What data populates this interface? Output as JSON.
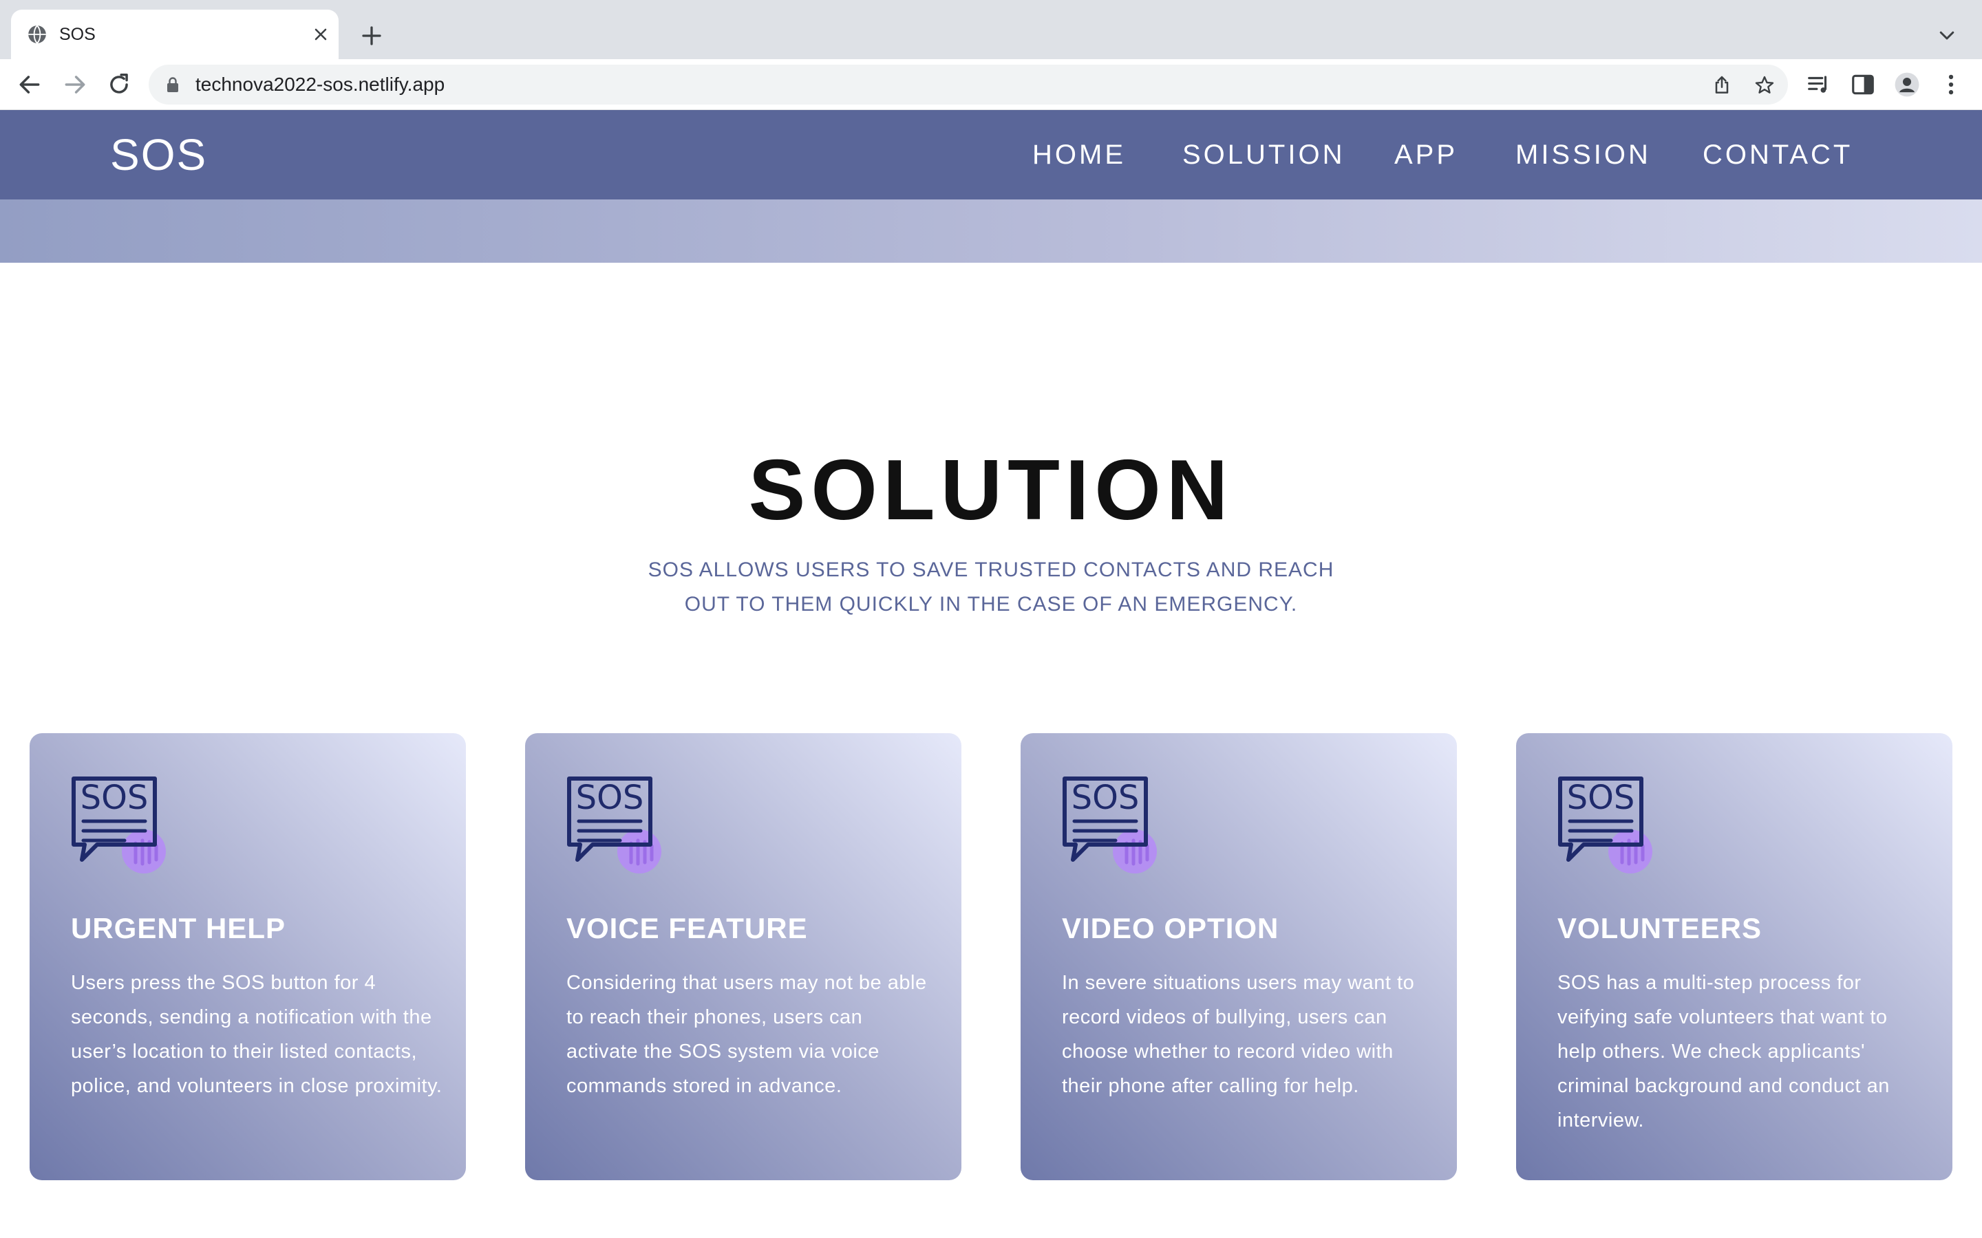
{
  "browser": {
    "tab_title": "SOS",
    "url": "technova2022-sos.netlify.app"
  },
  "site": {
    "logo": "SOS",
    "nav": [
      "HOME",
      "SOLUTION",
      "APP",
      "MISSION",
      "CONTACT"
    ]
  },
  "solution": {
    "title": "SOLUTION",
    "subtitle_line1": "SOS ALLOWS USERS TO SAVE TRUSTED CONTACTS AND REACH",
    "subtitle_line2": "OUT TO THEM QUICKLY IN THE CASE OF AN EMERGENCY.",
    "cards": [
      {
        "title": "URGENT HELP",
        "text": "Users press the SOS button for 4 seconds, sending a notification with the user’s location to their listed contacts, police, and volunteers in close proximity."
      },
      {
        "title": "VOICE FEATURE",
        "text": "Considering that users may not be able to reach their phones, users can activate the SOS system via voice commands stored in advance."
      },
      {
        "title": "VIDEO OPTION",
        "text": "In severe situations users may want to record videos of bullying, users can choose whether to record video with their phone after calling for help."
      },
      {
        "title": "VOLUNTEERS",
        "text": "SOS has a multi-step process for veifying safe volunteers that want to help others. We check applicants' criminal background and conduct an interview."
      }
    ],
    "icon_text": "SOS"
  },
  "colors": {
    "nav_bg": "#5a6699",
    "accent_text": "#5a6699",
    "icon_stroke": "#1f2a6b",
    "icon_hand": "#b58cf5"
  }
}
